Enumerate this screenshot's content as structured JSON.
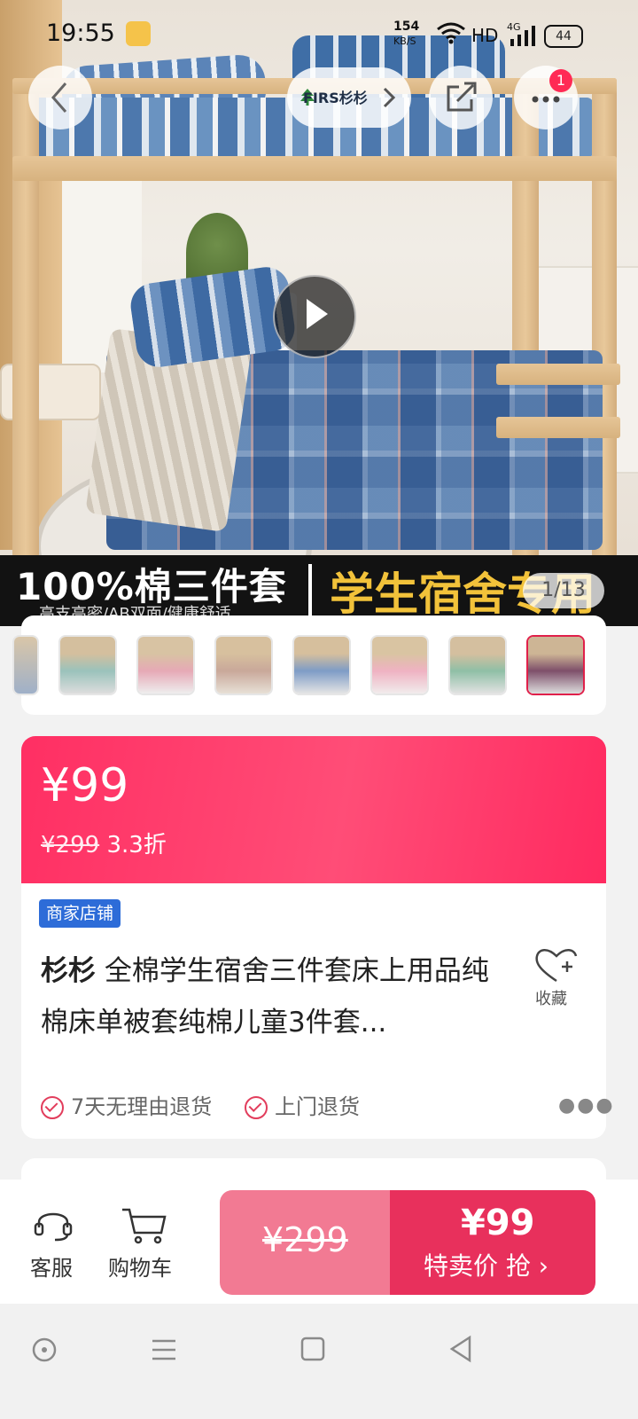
{
  "status_bar": {
    "time": "19:55",
    "speed_value": "154",
    "speed_unit": "KB/S",
    "network": "HD",
    "signal": "4G",
    "battery": "44"
  },
  "top_nav": {
    "brand": "FIRS杉杉",
    "badge_count": "1"
  },
  "hero": {
    "banner_left": "100%棉三件套",
    "banner_sub": "高支高密/AB双面/健康舒适",
    "banner_right": "学生宿舍专用",
    "counter": "1/13"
  },
  "price": {
    "current": "¥99",
    "original": "¥299",
    "discount": "3.3折"
  },
  "product": {
    "shop_tag": "商家店铺",
    "brand": "杉杉",
    "title_rest": " 全棉学生宿舍三件套床上用品纯棉床单被套纯棉儿童3件套...",
    "favorite_label": "收藏",
    "services": [
      "7天无理由退货",
      "上门退货"
    ]
  },
  "bottom_bar": {
    "service_label": "客服",
    "cart_label": "购物车",
    "old_price": "¥299",
    "new_price": "¥99",
    "cta": "特卖价 抢 ›"
  },
  "colors": {
    "accent": "#ff2f63",
    "buy_light": "#f27a93",
    "buy_dark": "#e8305c",
    "tag_blue": "#2d6cd8"
  }
}
